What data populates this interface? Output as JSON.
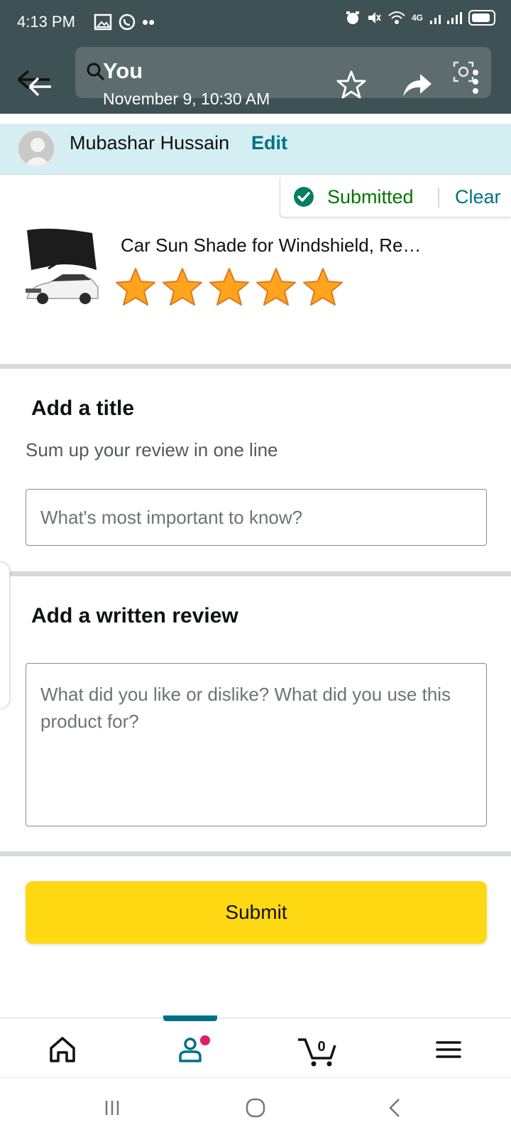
{
  "status_bar": {
    "time": "4:13 PM",
    "network": "4G"
  },
  "viewer": {
    "title": "You",
    "subtitle": "November 9, 10:30 AM"
  },
  "user": {
    "name": "Mubashar Hussain",
    "edit_label": "Edit"
  },
  "review_status": {
    "label": "Submitted",
    "clear_label": "Clear"
  },
  "product": {
    "title": "Car Sun Shade for Windshield, Re…",
    "rating": 5,
    "rating_max": 5
  },
  "title_section": {
    "heading": "Add a title",
    "subheading": "Sum up your review in one line",
    "input_placeholder": "What's most important to know?",
    "input_value": ""
  },
  "review_section": {
    "heading": "Add a written review",
    "textarea_placeholder": "What did you like or dislike? What did you use this product for?",
    "textarea_value": ""
  },
  "submit_label": "Submit",
  "bottom_nav": {
    "cart_count": "0",
    "active_tab": "you"
  },
  "colors": {
    "accent": "#007185",
    "submitted_green": "#007600",
    "submit_yellow": "#ffd814",
    "user_strip_bg": "#d5eef2",
    "star_gold": "#ffa41c",
    "notification_dot": "#e3196a"
  }
}
